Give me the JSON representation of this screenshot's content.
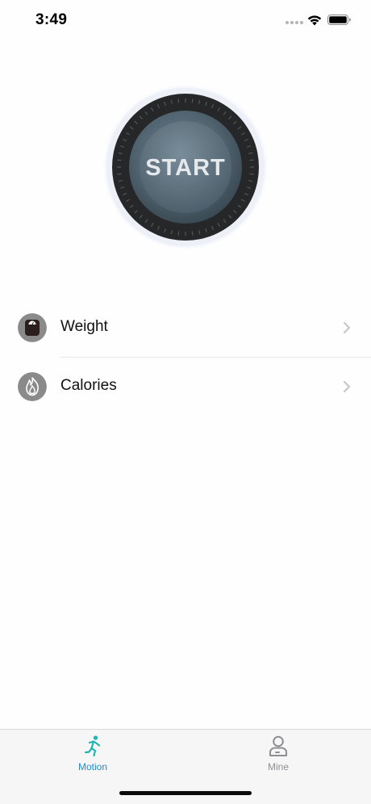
{
  "status_bar": {
    "time": "3:49",
    "icons": [
      "signal-dots-icon",
      "wifi-icon",
      "battery-icon"
    ]
  },
  "start_button": {
    "label": "START"
  },
  "menu": {
    "items": [
      {
        "label": "Weight",
        "icon": "scale-icon"
      },
      {
        "label": "Calories",
        "icon": "flame-icon"
      }
    ]
  },
  "tab_bar": {
    "tabs": [
      {
        "label": "Motion",
        "icon": "running-person-icon",
        "selected": true
      },
      {
        "label": "Mine",
        "icon": "person-icon",
        "selected": false
      }
    ]
  },
  "colors": {
    "accent": "#1f8bd1",
    "motion_icon": "#1fb5b0",
    "inactive": "#8e8e93",
    "icon_circle": "#8a8a8a",
    "start_face": "#4e6474"
  }
}
